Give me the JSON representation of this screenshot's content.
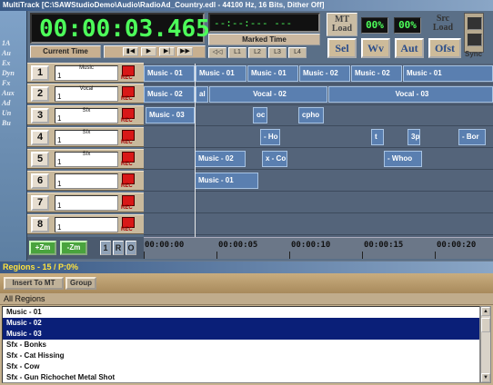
{
  "window": {
    "title": "MultiTrack  [C:\\SAWStudioDemo\\Audio\\RadioAd_Country.edl - 44100 Hz, 16 Bits, Dither Off]"
  },
  "transport": {
    "time_display": "00:00:03.465",
    "current_time_label": "Current Time",
    "buttons": [
      "▮◀",
      "▶",
      "▶|",
      "▶▶"
    ],
    "marked_time_display": "--:--:--- ---",
    "marked_time_label": "Marked Time",
    "bottom_buttons": [
      "◁◁",
      "L1",
      "L2",
      "L3",
      "L4"
    ]
  },
  "load": {
    "mt_load_label": "MT\nLoad",
    "mt_load_pct": "00%",
    "src_load_pct": "00%",
    "src_load_label": "Src\nLoad",
    "sync_label": "Sync"
  },
  "mode_buttons": [
    "Sel",
    "Wv",
    "Aut",
    "Ofst"
  ],
  "tracks": [
    {
      "num": "1",
      "name": "Music",
      "channel": "1",
      "rec": "REC"
    },
    {
      "num": "2",
      "name": "Vocal",
      "channel": "1",
      "rec": "REC"
    },
    {
      "num": "3",
      "name": "Sfx",
      "channel": "1",
      "rec": "REC"
    },
    {
      "num": "4",
      "name": "Sfx",
      "channel": "1",
      "rec": "REC"
    },
    {
      "num": "5",
      "name": "Sfx",
      "channel": "1",
      "rec": "REC"
    },
    {
      "num": "6",
      "name": "",
      "channel": "1",
      "rec": "REC"
    },
    {
      "num": "7",
      "name": "",
      "channel": "1",
      "rec": "REC"
    },
    {
      "num": "8",
      "name": "",
      "channel": "1",
      "rec": "REC"
    }
  ],
  "clips": {
    "lane1": [
      "Music - 01",
      "Music - 01",
      "Music - 01",
      "Music - 02",
      "Music - 02",
      "Music - 01"
    ],
    "lane2": [
      "Music - 02",
      "al",
      "Vocal - 02",
      "Vocal - 03"
    ],
    "lane3": [
      "Music - 03",
      "oc",
      "cpho"
    ],
    "lane4": [
      "- Ho",
      "t",
      "3p",
      "- Bor"
    ],
    "lane5": [
      "Music - 02",
      "x - Co",
      "- Whoo"
    ],
    "lane6": [
      "Music - 01"
    ]
  },
  "zoom_buttons": [
    "+Zm",
    "-Zm"
  ],
  "view_buttons": [
    "1",
    "R",
    "O"
  ],
  "ruler_ticks": [
    "00:00:00",
    "00:00:05",
    "00:00:10",
    "00:00:15",
    "00:00:20"
  ],
  "regions": {
    "title": "Regions - 15 / P:0%",
    "insert_label": "Insert To MT",
    "group_label": "Group",
    "all_regions_label": "All Regions",
    "items": [
      {
        "label": "Music - 01",
        "selected": false
      },
      {
        "label": "Music - 02",
        "selected": true
      },
      {
        "label": "Music - 03",
        "selected": true
      },
      {
        "label": "Sfx - Bonks",
        "selected": false
      },
      {
        "label": "Sfx - Cat Hissing",
        "selected": false
      },
      {
        "label": "Sfx - Cow",
        "selected": false
      },
      {
        "label": "Sfx - Gun Richochet Metal Shot",
        "selected": false
      }
    ]
  },
  "leftbar_text": "1A\nAu\nEx\nDyn\nFx\nAux\nAd\nUn\nBu",
  "colors": {
    "lcd_green": "#4dff5a",
    "clip_blue": "#5a7fb0",
    "selection": "#0a1f78",
    "rec_red": "#d81818",
    "regions_title_text": "#ffe23d"
  }
}
